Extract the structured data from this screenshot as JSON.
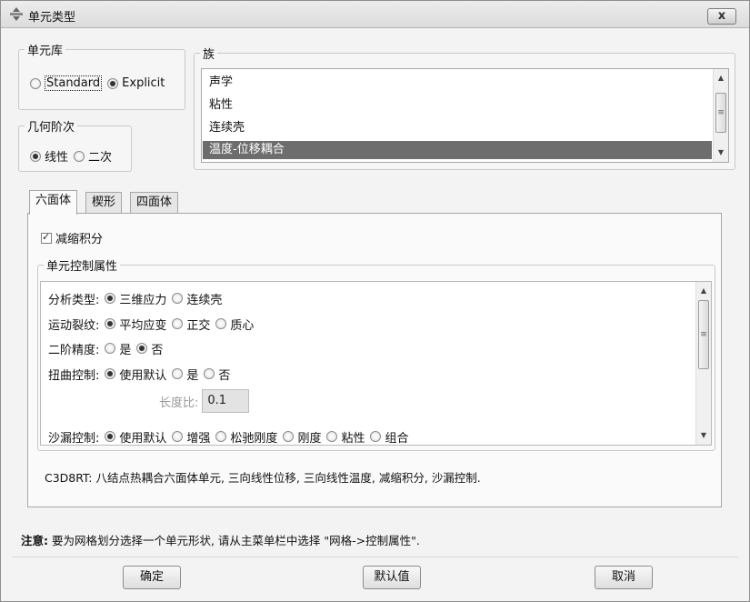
{
  "window": {
    "title": "单元类型",
    "close_label": "x"
  },
  "library": {
    "legend": "单元库",
    "options": [
      "Standard",
      "Explicit"
    ],
    "selected": "Explicit"
  },
  "geometric_order": {
    "legend": "几何阶次",
    "options": [
      "线性",
      "二次"
    ],
    "selected": "线性"
  },
  "family": {
    "legend": "族",
    "items": [
      "声学",
      "粘性",
      "连续壳",
      "温度-位移耦合"
    ],
    "selected": "温度-位移耦合"
  },
  "tabs": [
    {
      "label": "六面体",
      "active": true
    },
    {
      "label": "楔形",
      "active": false
    },
    {
      "label": "四面体",
      "active": false
    }
  ],
  "reduced_integration": {
    "label": "减缩积分",
    "checked": true
  },
  "element_controls": {
    "legend": "单元控制属性",
    "rows": [
      {
        "label": "分析类型:",
        "options": [
          "三维应力",
          "连续壳"
        ],
        "selected": 0
      },
      {
        "label": "运动裂纹:",
        "options": [
          "平均应变",
          "正交",
          "质心"
        ],
        "selected": 0
      },
      {
        "label": "二阶精度:",
        "options": [
          "是",
          "否"
        ],
        "selected": 1
      },
      {
        "label": "扭曲控制:",
        "options": [
          "使用默认",
          "是",
          "否"
        ],
        "selected": 0
      },
      {
        "label": "沙漏控制:",
        "options": [
          "使用默认",
          "增强",
          "松驰刚度",
          "刚度",
          "粘性",
          "组合"
        ],
        "selected": 0
      }
    ],
    "length_ratio_label": "长度比:",
    "length_ratio_value": "0.1"
  },
  "description": "C3D8RT:  八结点热耦合六面体单元, 三向线性位移, 三向线性温度, 减缩积分, 沙漏控制.",
  "note": {
    "prefix": "注意:",
    "text": " 要为网格划分选择一个单元形状, 请从主菜单栏中选择 \"网格->控制属性\"."
  },
  "buttons": {
    "ok": "确定",
    "defaults": "默认值",
    "cancel": "取消"
  }
}
